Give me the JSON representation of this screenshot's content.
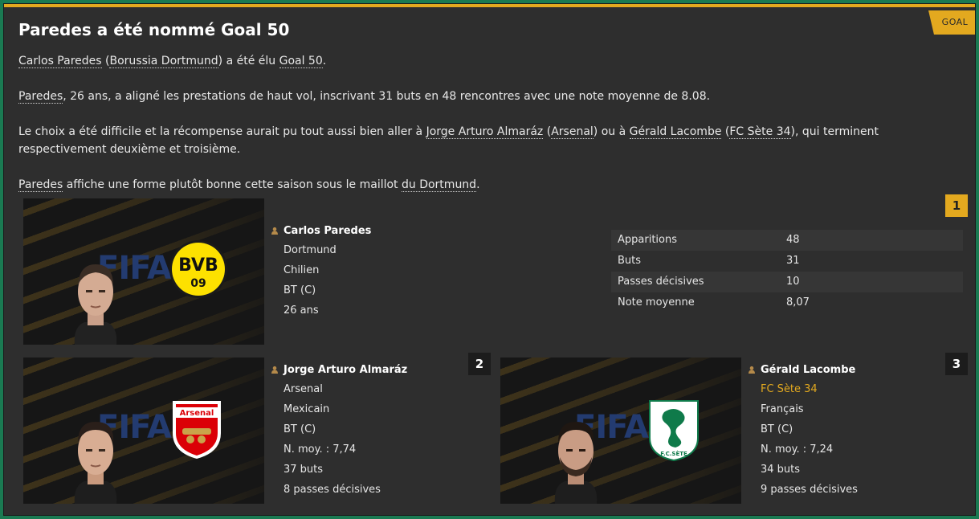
{
  "header": {
    "tag": "GOAL",
    "title": "Paredes a été nommé Goal 50"
  },
  "article": {
    "p1": {
      "a": "Carlos Paredes",
      "b": " (",
      "c": "Borussia Dortmund",
      "d": ") a été élu ",
      "e": "Goal 50",
      "f": "."
    },
    "p2": {
      "a": "Paredes",
      "b": ", 26 ans, a aligné les prestations de haut vol, inscrivant 31 buts en 48 rencontres avec une note moyenne de 8.08."
    },
    "p3": {
      "a": "Le choix a été difficile et la récompense aurait pu tout aussi bien aller à ",
      "b": "Jorge Arturo Almaráz",
      "c": " (",
      "d": "Arsenal",
      "e": ") ou à ",
      "f": "Gérald Lacombe",
      "g": " (",
      "h": "FC Sète 34",
      "i": "), qui terminent respectivement deuxième et troisième."
    },
    "p4": {
      "a": "Paredes",
      "b": " affiche une forme plutôt bonne cette saison sous le maillot ",
      "c": "du Dortmund",
      "d": "."
    }
  },
  "winner": {
    "rank": "1",
    "name": "Carlos Paredes",
    "club": "Dortmund",
    "nationality": "Chilien",
    "position": "BT (C)",
    "age": "26 ans",
    "crest_text": {
      "top": "BVB",
      "bottom": "09"
    },
    "stats": [
      {
        "label": "Apparitions",
        "value": "48"
      },
      {
        "label": "Buts",
        "value": "31"
      },
      {
        "label": "Passes décisives",
        "value": "10"
      },
      {
        "label": "Note moyenne",
        "value": "8,07"
      }
    ]
  },
  "second": {
    "rank": "2",
    "name": "Jorge Arturo Almaráz",
    "club": "Arsenal",
    "nationality": "Mexicain",
    "position": "BT (C)",
    "rating": "N. moy. : 7,74",
    "goals": "37 buts",
    "assists": "8 passes décisives",
    "crest_text": "Arsenal"
  },
  "third": {
    "rank": "3",
    "name": "Gérald Lacombe",
    "club": "FC Sète 34",
    "nationality": "Français",
    "position": "BT (C)",
    "rating": "N. moy. : 7,24",
    "goals": "34 buts",
    "assists": "9 passes décisives",
    "crest_text": "F.C.SÈTE"
  },
  "card_watermark": "FIFA",
  "colors": {
    "accent": "#e3a91f",
    "background": "#2e2e2e",
    "outer": "#1a7a52"
  }
}
